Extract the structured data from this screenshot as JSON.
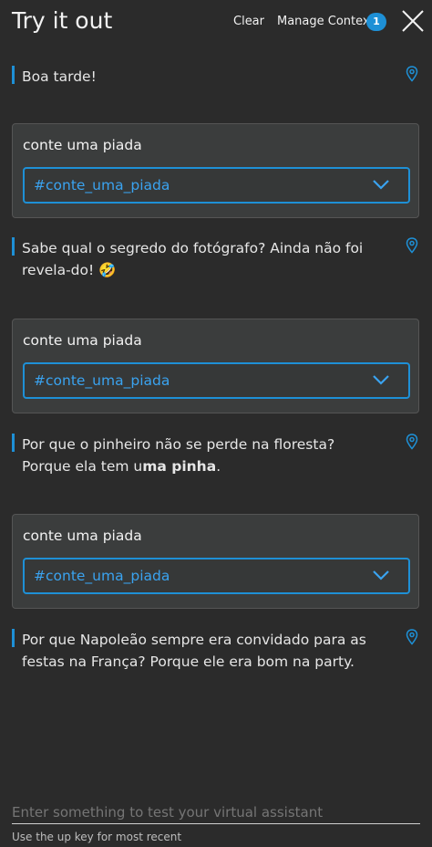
{
  "header": {
    "title": "Try it out",
    "clear_label": "Clear",
    "manage_context_label": "Manage Context",
    "context_count": "1"
  },
  "messages": [
    {
      "type": "bot",
      "text": "Boa tarde!"
    },
    {
      "type": "user",
      "question": "conte uma piada",
      "intent": "#conte_uma_piada"
    },
    {
      "type": "bot",
      "text": "Sabe qual o segredo do fotógrafo? Ainda não foi revela-do! 🤣"
    },
    {
      "type": "user",
      "question": "conte uma piada",
      "intent": "#conte_uma_piada"
    },
    {
      "type": "bot",
      "text_parts": [
        "Por que o pinheiro não se perde na floresta? Porque ela tem u",
        "ma pinha",
        "."
      ]
    },
    {
      "type": "user",
      "question": "conte uma piada",
      "intent": "#conte_uma_piada"
    },
    {
      "type": "bot",
      "text": "Por que Napoleão sempre era convidado para as festas na França? Porque ele era bom na party."
    }
  ],
  "input": {
    "placeholder": "Enter something to test your virtual assistant",
    "hint": "Use the up key for most recent"
  },
  "colors": {
    "accent": "#1e90d6",
    "background": "#2b2b2b",
    "card": "#3b3d3d"
  },
  "icons": {
    "close": "close-icon",
    "pin": "location-pin-icon",
    "chevron": "chevron-down-icon"
  }
}
